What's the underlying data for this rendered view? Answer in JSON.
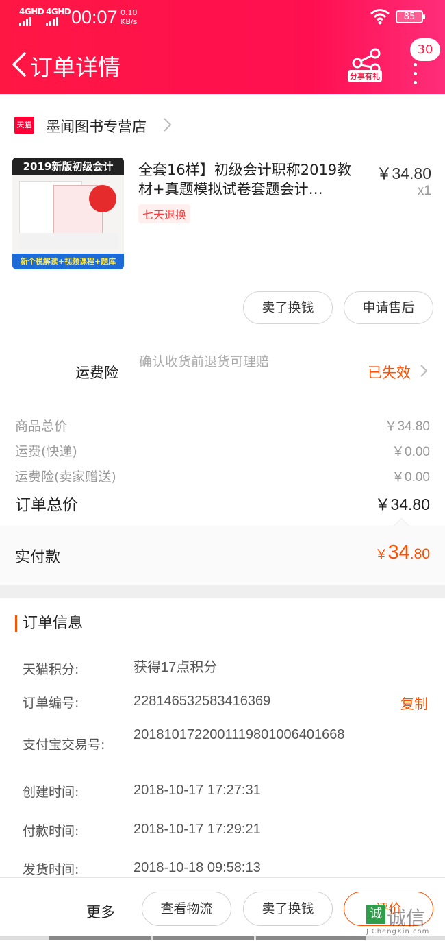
{
  "status": {
    "net1": "4GHD",
    "net2": "4GHD",
    "time": "00:07",
    "speed_value": "0.10",
    "speed_unit": "KB/s",
    "battery": "85"
  },
  "header": {
    "title": "订单详情",
    "share_label": "分享有礼",
    "message_count": "30"
  },
  "store": {
    "badge": "天猫",
    "name": "墨闻图书专营店"
  },
  "product": {
    "title": "全套16样】初级会计职称2019教材+真题模拟试卷套题会计…",
    "tag": "七天退换",
    "price": "￥34.80",
    "quantity": "x1",
    "cover_banner": "2019新版初级会计",
    "cover_footer": "新个税解读+视频课程+题库"
  },
  "actions": {
    "sell": "卖了换钱",
    "after_sale": "申请售后"
  },
  "insurance": {
    "label": "运费险",
    "desc": "确认收货前退货可理赔",
    "status": "已失效"
  },
  "costs": [
    {
      "label": "商品总价",
      "value": "￥34.80"
    },
    {
      "label": "运费(快递)",
      "value": "￥0.00"
    },
    {
      "label": "运费险(卖家赠送)",
      "value": "￥0.00"
    }
  ],
  "order_total": {
    "label": "订单总价",
    "value": "￥34.80"
  },
  "paid": {
    "label": "实付款",
    "currency": "￥",
    "integer": "34",
    "decimal": ".80"
  },
  "info": {
    "title": "订单信息",
    "rows": [
      {
        "key": "天猫积分:",
        "value": "获得17点积分"
      },
      {
        "key": "订单编号:",
        "value": "228146532583416369"
      },
      {
        "key": "支付宝交易号:",
        "value": "2018101722001119801006401668"
      },
      {
        "key": "创建时间:",
        "value": "2018-10-17 17:27:31"
      },
      {
        "key": "付款时间:",
        "value": "2018-10-17 17:29:21"
      },
      {
        "key": "发货时间:",
        "value": "2018-10-18 09:58:13"
      }
    ],
    "copy": "复制"
  },
  "bottom": {
    "more": "更多",
    "logistics": "查看物流",
    "sell": "卖了换钱",
    "review": "评价"
  },
  "watermark": {
    "box": "诚",
    "text": "诚信",
    "sub": "JiChengXin.com"
  }
}
